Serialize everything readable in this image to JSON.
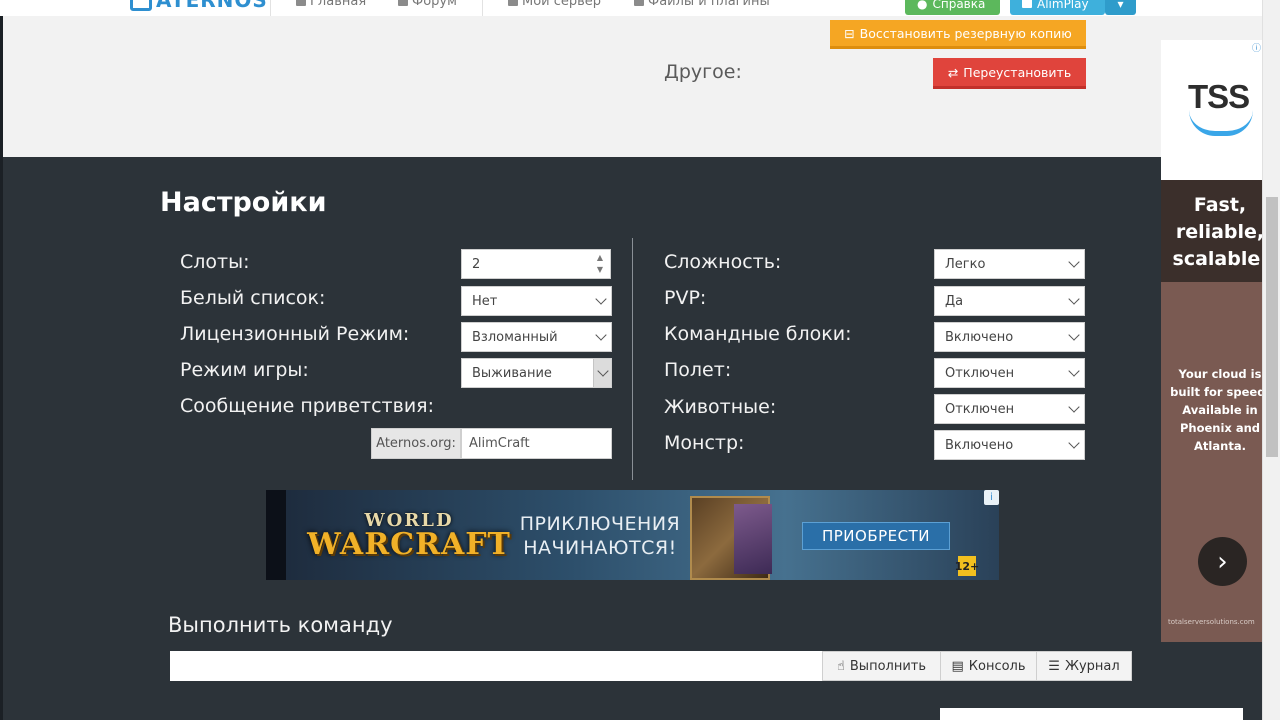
{
  "topbar": {
    "logo": "ATERNOS",
    "nav": [
      {
        "icon": "home-icon",
        "label": "Главная"
      },
      {
        "icon": "user-icon",
        "label": "Форум"
      },
      {
        "icon": "server-icon",
        "label": "Мой сервер"
      },
      {
        "icon": "folder-icon",
        "label": "Файлы и плагины"
      }
    ],
    "help_label": "Справка",
    "account_label": "AlimPlay"
  },
  "upper": {
    "restore_button": "Восстановить резервную копию",
    "other_label": "Другое:",
    "reinstall_button": "Переустановить"
  },
  "settings": {
    "title": "Настройки",
    "left": [
      {
        "label": "Слоты:",
        "value": "2",
        "type": "number"
      },
      {
        "label": "Белый список:",
        "value": "Нет",
        "type": "select"
      },
      {
        "label": "Лицензионный Режим:",
        "value": "Взломанный",
        "type": "select"
      },
      {
        "label": "Режим игры:",
        "value": "Выживание",
        "type": "select"
      }
    ],
    "motd": {
      "label": "Сообщение приветствия:",
      "addon": "Aternos.org:",
      "value": "AlimCraft"
    },
    "right": [
      {
        "label": "Сложность:",
        "value": "Легко"
      },
      {
        "label": "PVP:",
        "value": "Да"
      },
      {
        "label": "Командные блоки:",
        "value": "Включено"
      },
      {
        "label": "Полет:",
        "value": "Отключен"
      },
      {
        "label": "Животные:",
        "value": "Отключен"
      },
      {
        "label": "Монстр:",
        "value": "Включено"
      }
    ]
  },
  "banner": {
    "logo_top": "WORLD",
    "logo_bottom": "WARCRAFT",
    "text": "ПРИКЛЮЧЕНИЯ НАЧИНАЮТСЯ!",
    "button": "ПРИОБРЕСТИ",
    "age": "12+"
  },
  "command": {
    "title": "Выполнить команду",
    "input_value": "",
    "execute_label": "Выполнить",
    "console_label": "Консоль",
    "log_label": "Журнал"
  },
  "side_ad": {
    "brand": "TSS",
    "headline": "Fast, reliable, scalable.",
    "body": "Your cloud is built for speed. Available in Phoenix and Atlanta.",
    "footer": "totalserversolutions.com"
  },
  "colors": {
    "dark_bg": "#2c3339",
    "restore": "#f5a623",
    "reinstall": "#e0443c",
    "help": "#5cb85c",
    "account": "#3eb0dc"
  }
}
